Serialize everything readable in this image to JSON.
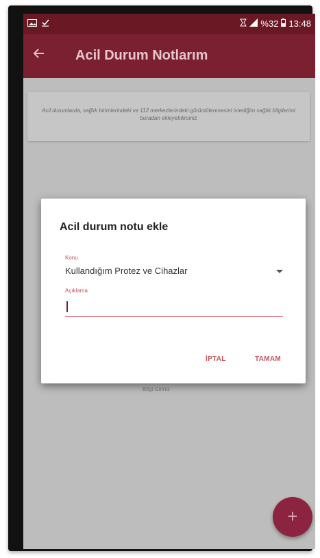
{
  "status_bar": {
    "left_icons": [
      "image-icon",
      "download-check-icon"
    ],
    "battery_text": "%32",
    "time": "13:48"
  },
  "app_bar": {
    "title": "Acil Durum Notlarım"
  },
  "info_card": {
    "text": "Acil durumlarda, sağlık birimlerindeki ve 112 merkezlerindeki görüntülenmesini istediğim sağlık bilgilerimi buradan ekleyebilirsiniz"
  },
  "behind_dialog": {
    "text": "Bilgi Giriniz"
  },
  "dialog": {
    "title": "Acil durum notu ekle",
    "subject_label": "Konu",
    "subject_value": "Kullandığım Protez ve Cihazlar",
    "description_label": "Açıklama",
    "description_value": "",
    "cancel_label": "İPTAL",
    "ok_label": "TAMAM"
  },
  "fab": {
    "label": "+"
  },
  "colors": {
    "appbar": "#7a2030",
    "statusbar": "#6b1825",
    "accent": "#c2555f",
    "fab": "#8c2340"
  }
}
